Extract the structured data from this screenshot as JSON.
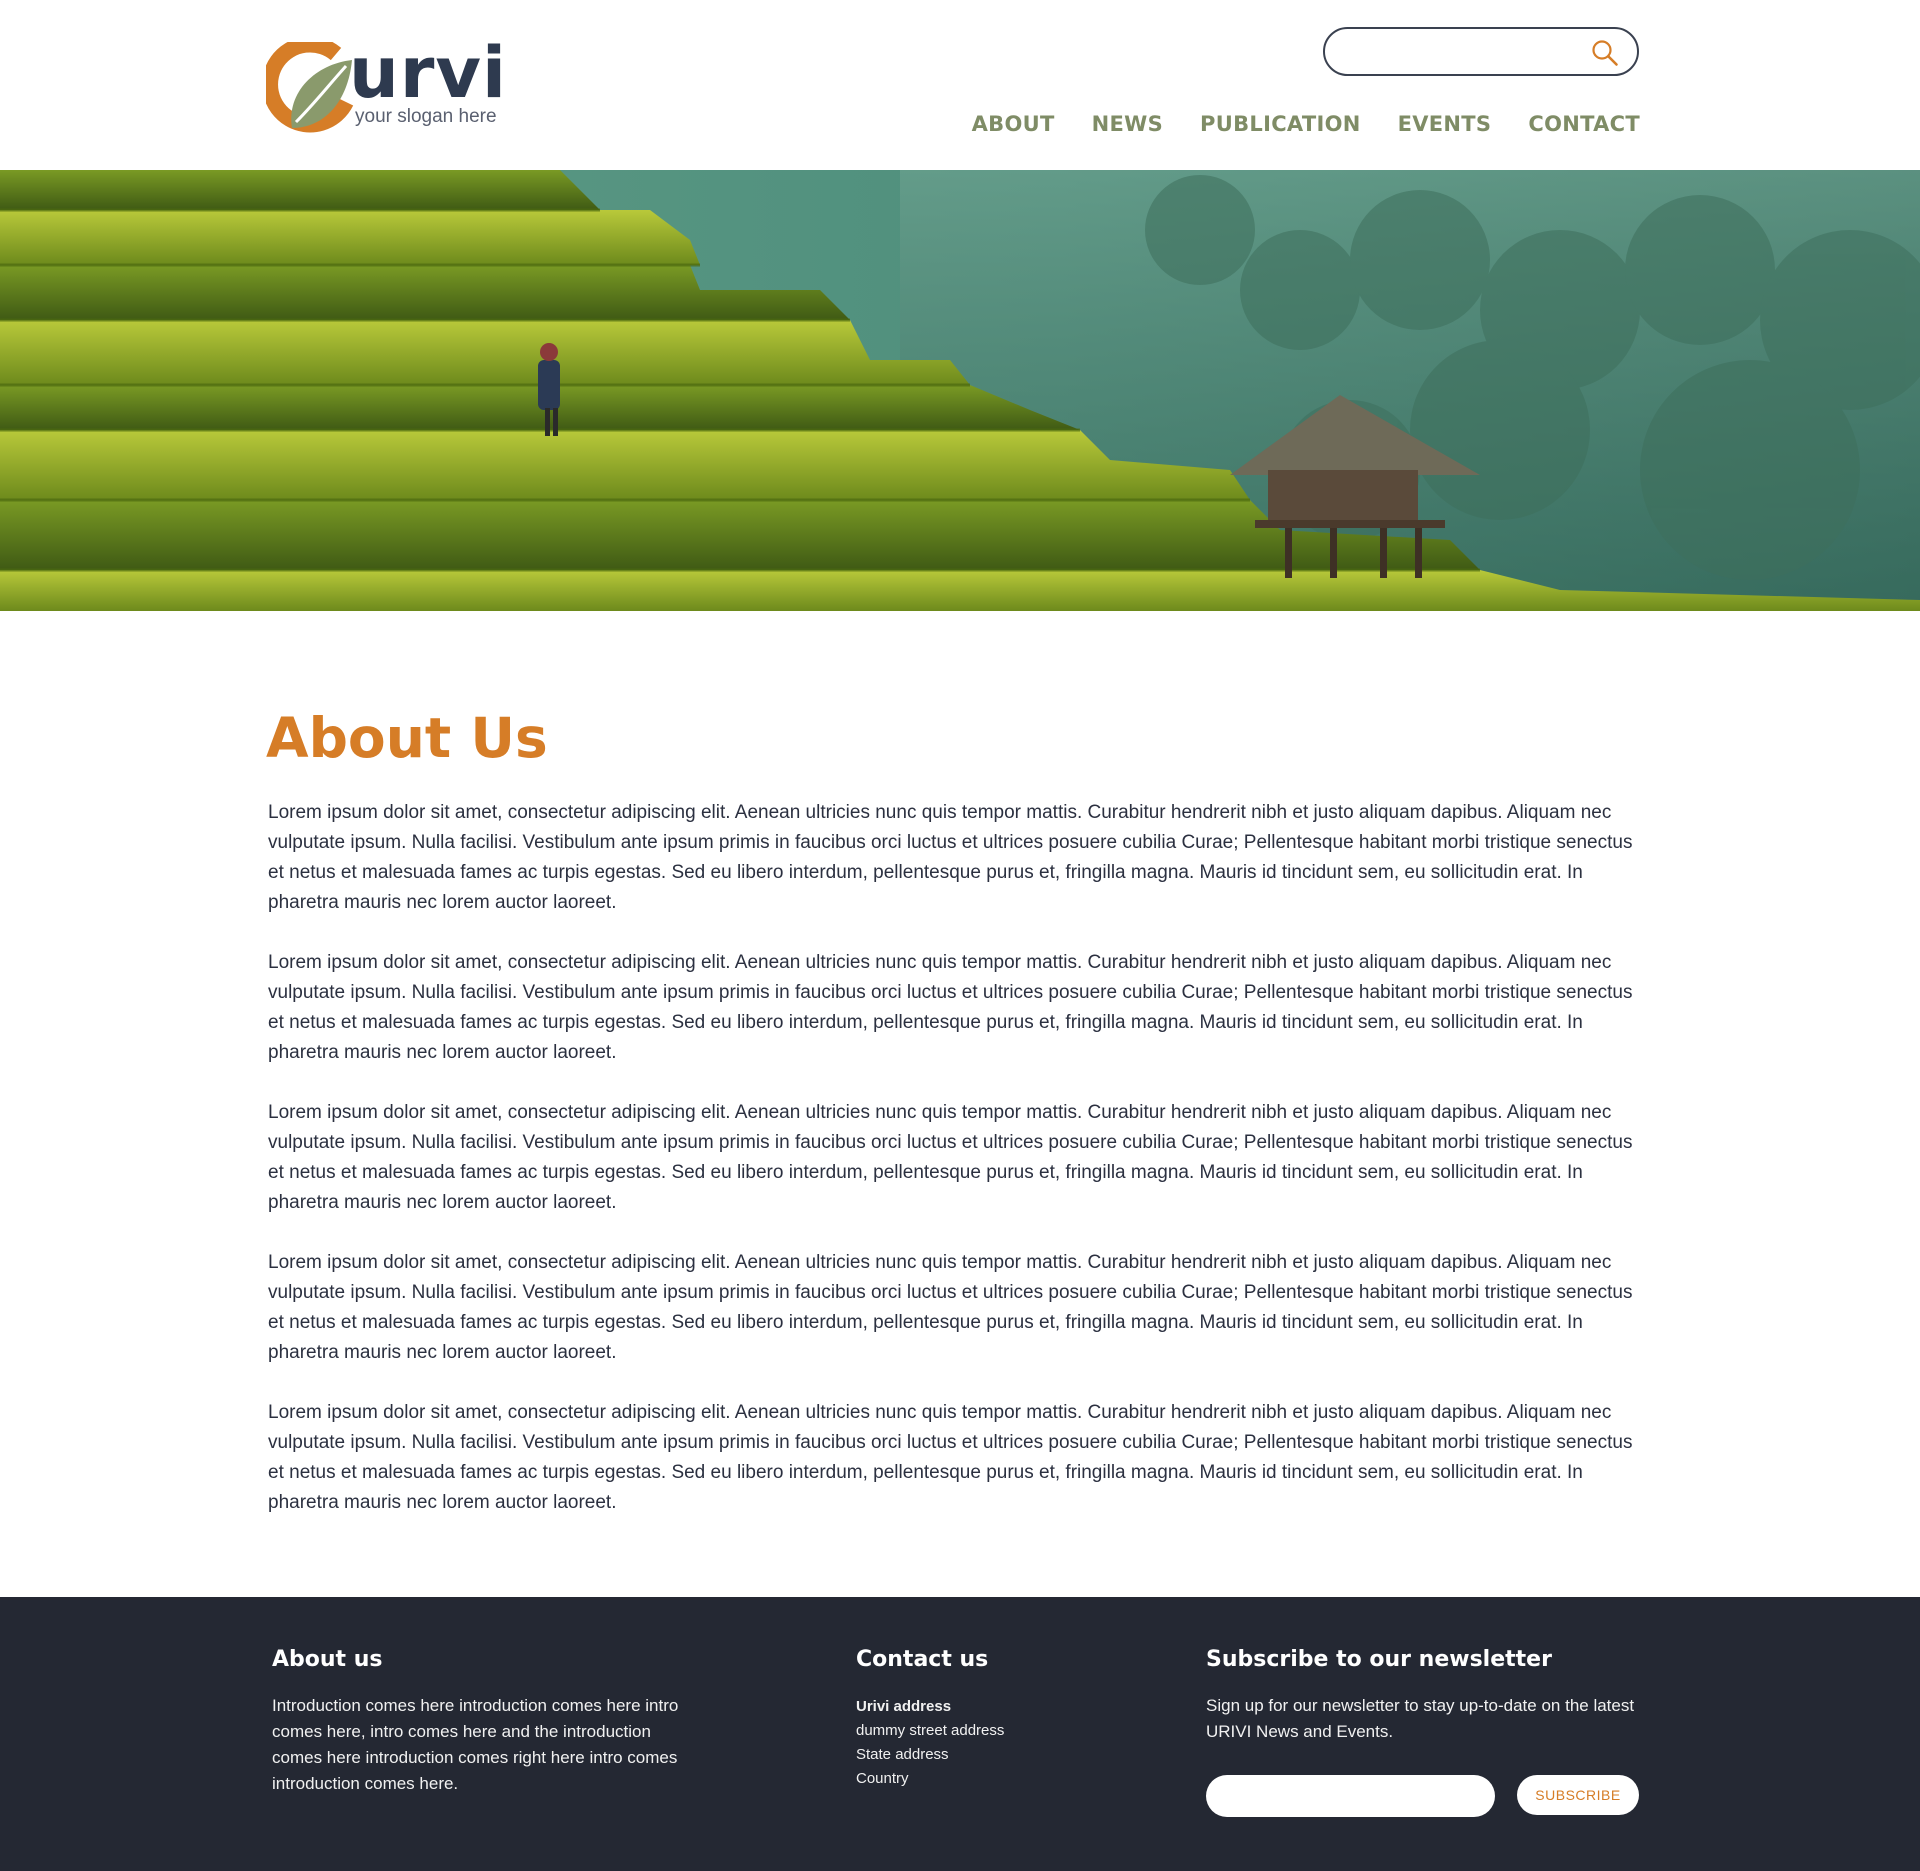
{
  "brand": {
    "name": "urvi",
    "slogan": "your slogan here",
    "colors": {
      "orange": "#d67d27",
      "sage": "#7f8c66",
      "navy": "#2e3a4f",
      "footer_bg": "#242833"
    }
  },
  "search": {
    "placeholder": "",
    "icon": "search-icon"
  },
  "nav": {
    "items": [
      {
        "label": "ABOUT"
      },
      {
        "label": "NEWS"
      },
      {
        "label": "PUBLICATION"
      },
      {
        "label": "EVENTS"
      },
      {
        "label": "CONTACT"
      }
    ]
  },
  "hero": {
    "image": "rice-terraces-with-hut"
  },
  "main": {
    "title": "About Us",
    "paragraphs": [
      "Lorem ipsum dolor sit amet, consectetur adipiscing elit. Aenean ultricies nunc quis tempor mattis. Curabitur hendrerit nibh et justo aliquam dapibus. Aliquam nec vulputate ipsum. Nulla facilisi. Vestibulum ante ipsum primis in faucibus orci luctus et ultrices posuere cubilia Curae; Pellentesque habitant morbi tristique senectus et netus et malesuada fames ac turpis egestas. Sed eu libero interdum, pellentesque purus et, fringilla magna. Mauris id tincidunt sem, eu sollicitudin erat. In pharetra mauris nec lorem auctor laoreet.",
      "Lorem ipsum dolor sit amet, consectetur adipiscing elit. Aenean ultricies nunc quis tempor mattis. Curabitur hendrerit nibh et justo aliquam dapibus. Aliquam nec vulputate ipsum. Nulla facilisi. Vestibulum ante ipsum primis in faucibus orci luctus et ultrices posuere cubilia Curae; Pellentesque habitant morbi tristique senectus et netus et malesuada fames ac turpis egestas. Sed eu libero interdum, pellentesque purus et, fringilla magna. Mauris id tincidunt sem, eu sollicitudin erat. In pharetra mauris nec lorem auctor laoreet.",
      "Lorem ipsum dolor sit amet, consectetur adipiscing elit. Aenean ultricies nunc quis tempor mattis. Curabitur hendrerit nibh et justo aliquam dapibus. Aliquam nec vulputate ipsum. Nulla facilisi. Vestibulum ante ipsum primis in faucibus orci luctus et ultrices posuere cubilia Curae; Pellentesque habitant morbi tristique senectus et netus et malesuada fames ac turpis egestas. Sed eu libero interdum, pellentesque purus et, fringilla magna. Mauris id tincidunt sem, eu sollicitudin erat. In pharetra mauris nec lorem auctor laoreet.",
      "Lorem ipsum dolor sit amet, consectetur adipiscing elit. Aenean ultricies nunc quis tempor mattis. Curabitur hendrerit nibh et justo aliquam dapibus. Aliquam nec vulputate ipsum. Nulla facilisi. Vestibulum ante ipsum primis in faucibus orci luctus et ultrices posuere cubilia Curae; Pellentesque habitant morbi tristique senectus et netus et malesuada fames ac turpis egestas. Sed eu libero interdum, pellentesque purus et, fringilla magna. Mauris id tincidunt sem, eu sollicitudin erat. In pharetra mauris nec lorem auctor laoreet.",
      "Lorem ipsum dolor sit amet, consectetur adipiscing elit. Aenean ultricies nunc quis tempor mattis. Curabitur hendrerit nibh et justo aliquam dapibus. Aliquam nec vulputate ipsum. Nulla facilisi. Vestibulum ante ipsum primis in faucibus orci luctus et ultrices posuere cubilia Curae; Pellentesque habitant morbi tristique senectus et netus et malesuada fames ac turpis egestas. Sed eu libero interdum, pellentesque purus et, fringilla magna. Mauris id tincidunt sem, eu sollicitudin erat. In pharetra mauris nec lorem auctor laoreet."
    ]
  },
  "footer": {
    "about": {
      "title": "About us",
      "text": "Introduction comes here introduction comes here intro comes here, intro comes here and the introduction comes here introduction comes right here intro comes introduction comes here."
    },
    "contact": {
      "title": "Contact us",
      "lines": [
        "Urivi  address",
        "dummy street address",
        "State address",
        "Country"
      ]
    },
    "newsletter": {
      "title": "Subscribe to our newsletter",
      "text": "Sign up for our newsletter to stay up-to-date on the latest URIVI News and Events.",
      "email_placeholder": "",
      "button_label": "SUBSCRIBE"
    }
  }
}
